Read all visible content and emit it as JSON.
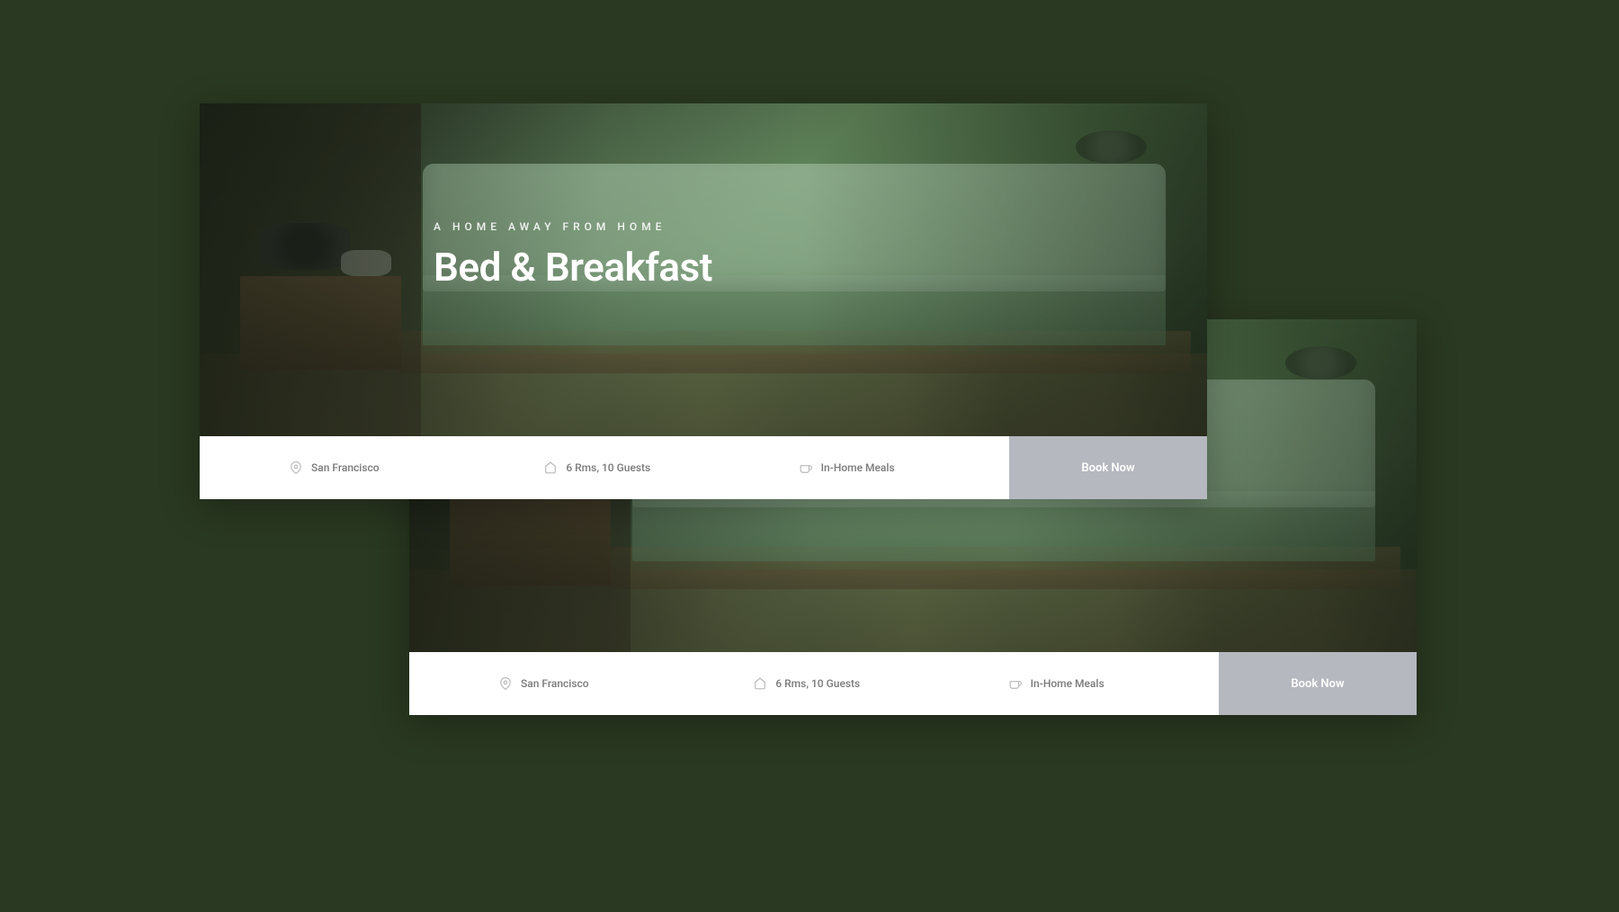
{
  "hero": {
    "tagline": "A HOME AWAY FROM HOME",
    "title": "Bed & Breakfast"
  },
  "info": {
    "location": "San Francisco",
    "capacity": "6 Rms, 10 Guests",
    "meals": "In-Home Meals"
  },
  "cta": {
    "book": "Book Now"
  }
}
